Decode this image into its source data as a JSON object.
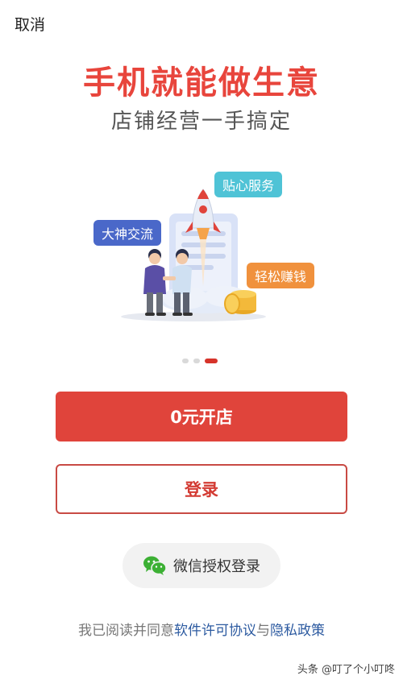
{
  "header": {
    "cancel_label": "取消"
  },
  "hero": {
    "title": "手机就能做生意",
    "subtitle": "店铺经营一手搞定",
    "tags": {
      "service": "贴心服务",
      "exchange": "大神交流",
      "earn": "轻松赚钱"
    }
  },
  "carousel": {
    "total": 3,
    "active_index": 2
  },
  "actions": {
    "open_store_label": "0元开店",
    "login_label": "登录",
    "wechat_login_label": "微信授权登录"
  },
  "agreement": {
    "prefix": "我已阅读并同意",
    "license_link": "软件许可协议",
    "and": "与",
    "privacy_link": "隐私政策"
  },
  "watermark": {
    "text": "头条 @叮了个小叮咚"
  },
  "colors": {
    "accent": "#e0443b",
    "link": "#2c5aa0"
  }
}
